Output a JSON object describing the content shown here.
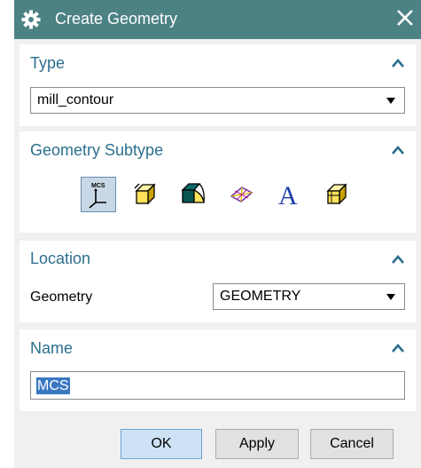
{
  "window": {
    "title": "Create Geometry"
  },
  "icons": {
    "title": "gear-icon",
    "close": "close-icon",
    "collapse": "chevron-up-icon",
    "dropdown": "chevron-down-icon"
  },
  "colors": {
    "titlebar": "#4d8285",
    "section_title": "#2c6f8e",
    "selection": "#3b78c2",
    "ok_button": "#cde3f5"
  },
  "type_section": {
    "title": "Type",
    "selected": "mill_contour"
  },
  "subtype_section": {
    "title": "Geometry Subtype",
    "items": [
      {
        "icon": "mcs-icon",
        "label": "MCS",
        "selected": true
      },
      {
        "icon": "workpiece-icon",
        "selected": false
      },
      {
        "icon": "mill-area-icon",
        "selected": false
      },
      {
        "icon": "mill-boundary-icon",
        "selected": false
      },
      {
        "icon": "mill-text-icon",
        "label": "A",
        "selected": false
      },
      {
        "icon": "mill-geom-icon",
        "selected": false
      }
    ]
  },
  "location_section": {
    "title": "Location",
    "geometry_label": "Geometry",
    "geometry_value": "GEOMETRY"
  },
  "name_section": {
    "title": "Name",
    "value": "MCS"
  },
  "buttons": {
    "ok": "OK",
    "apply": "Apply",
    "cancel": "Cancel"
  }
}
